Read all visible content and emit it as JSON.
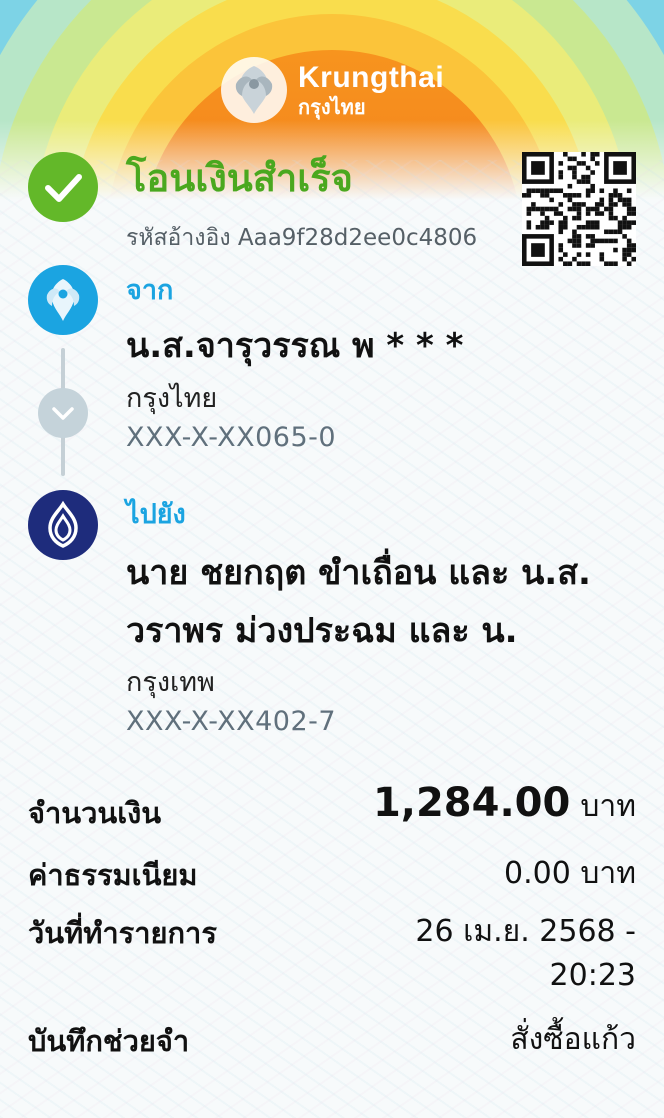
{
  "header": {
    "brand_en": "Krungthai",
    "brand_th": "กรุงไทย",
    "colors": {
      "sun": "#f07a1c",
      "band_yellow": "#f8e24a",
      "band_green": "#a8dc7a",
      "band_cyan": "#55c9e6"
    }
  },
  "status": {
    "title": "โอนเงินสำเร็จ",
    "reference": "รหัสอ้างอิง Aaa9f28d2ee0c4806",
    "icon": "check-icon",
    "color": "#63b829"
  },
  "from": {
    "label": "จาก",
    "name": "น.ส.จารุวรรณ พ * * *",
    "bank": "กรุงไทย",
    "account": "XXX-X-XX065-0",
    "icon": "krungthai-logo-icon"
  },
  "to": {
    "label": "ไปยัง",
    "name_line1": "นาย ชยกฤต ขำเถื่อน และ น.ส.",
    "name_line2": "วราพร ม่วงประฉม และ น.",
    "bank": "กรุงเทพ",
    "account": "XXX-X-XX402-7",
    "icon": "bangkok-bank-logo-icon"
  },
  "details": {
    "amount_label": "จำนวนเงิน",
    "amount": "1,284.00",
    "currency": "บาท",
    "fee_label": "ค่าธรรมเนียม",
    "fee": "0.00 บาท",
    "date_label": "วันที่ทำรายการ",
    "date_line1": "26 เม.ย. 2568 -",
    "date_line2": "20:23",
    "memo_label": "บันทึกช่วยจำ",
    "memo": "สั่งซื้อแก้ว"
  }
}
